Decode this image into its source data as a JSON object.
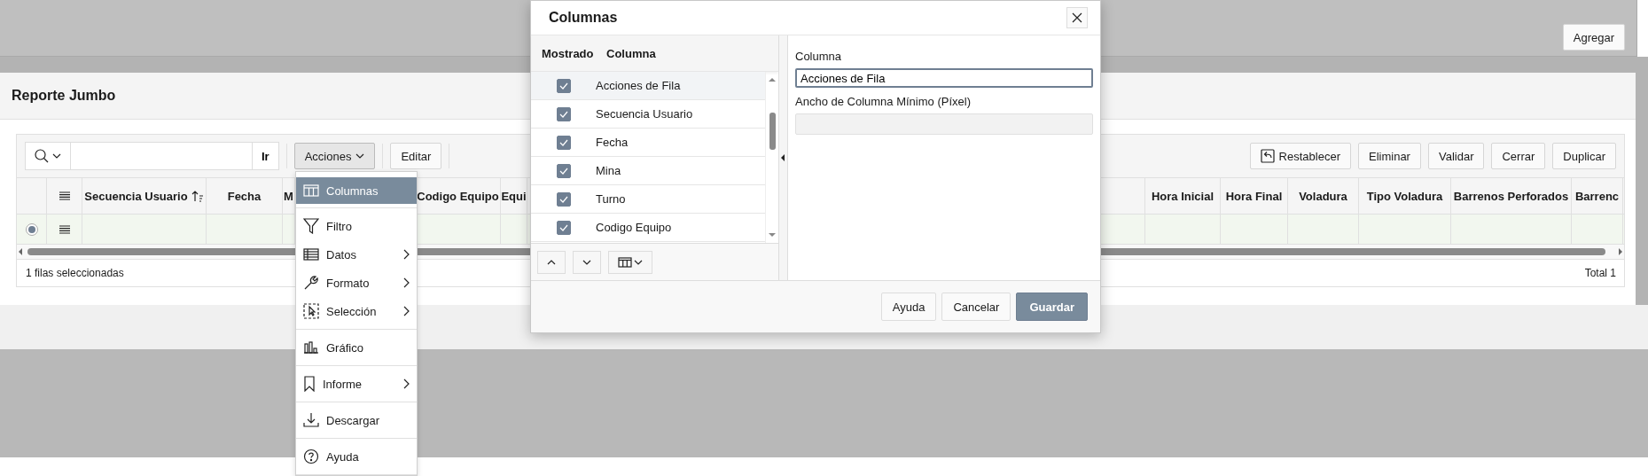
{
  "top_panel": {
    "button": "Agregar"
  },
  "report": {
    "title": "Reporte Jumbo",
    "toolbar": {
      "go_button": "Ir",
      "actions_button": "Acciones",
      "edit_button": "Editar",
      "right_buttons": [
        {
          "label": "Restablecer",
          "kind": "reset"
        },
        {
          "label": "Eliminar",
          "kind": "plain"
        },
        {
          "label": "Validar",
          "kind": "plain"
        },
        {
          "label": "Cerrar",
          "kind": "plain"
        },
        {
          "label": "Duplicar",
          "kind": "plain"
        }
      ]
    },
    "columns": [
      {
        "label": "Secuencia Usuario",
        "sorted": true
      },
      {
        "label": "Fecha",
        "sorted": false
      },
      {
        "label": "M",
        "sorted": false
      },
      {
        "label": "Codigo Equipo",
        "sorted": false
      },
      {
        "label": "Equi",
        "sorted": false
      },
      {
        "label": "Hora Inicial",
        "sorted": false
      },
      {
        "label": "Hora Final",
        "sorted": false
      },
      {
        "label": "Voladura",
        "sorted": false
      },
      {
        "label": "Tipo Voladura",
        "sorted": false
      },
      {
        "label": "Barrenos Perforados",
        "sorted": false
      },
      {
        "label": "Barrenc",
        "sorted": false
      }
    ],
    "rows": [
      {
        "selected": true
      }
    ],
    "footer": {
      "selection": "1 filas seleccionadas",
      "total": "Total 1"
    }
  },
  "actions_menu": {
    "groups": [
      [
        {
          "label": "Columnas",
          "selected": true,
          "submenu": false
        }
      ],
      [
        {
          "label": "Filtro",
          "selected": false,
          "submenu": false
        },
        {
          "label": "Datos",
          "selected": false,
          "submenu": true
        },
        {
          "label": "Formato",
          "selected": false,
          "submenu": true
        },
        {
          "label": "Selección",
          "selected": false,
          "submenu": true
        }
      ],
      [
        {
          "label": "Gráfico",
          "selected": false,
          "submenu": false
        }
      ],
      [
        {
          "label": "Informe",
          "selected": false,
          "submenu": true
        }
      ],
      [
        {
          "label": "Descargar",
          "selected": false,
          "submenu": false
        }
      ],
      [
        {
          "label": "Ayuda",
          "selected": false,
          "submenu": false
        }
      ]
    ]
  },
  "dialog": {
    "title": "Columnas",
    "list_headers": [
      "Mostrado",
      "Columna"
    ],
    "items": [
      {
        "label": "Acciones de Fila",
        "checked": true,
        "selected": true
      },
      {
        "label": "Secuencia Usuario",
        "checked": true,
        "selected": false
      },
      {
        "label": "Fecha",
        "checked": true,
        "selected": false
      },
      {
        "label": "Mina",
        "checked": true,
        "selected": false
      },
      {
        "label": "Turno",
        "checked": true,
        "selected": false
      },
      {
        "label": "Codigo Equipo",
        "checked": true,
        "selected": false
      }
    ],
    "fields": [
      {
        "label": "Columna",
        "value": "Acciones de Fila",
        "focused": true,
        "disabled": false
      },
      {
        "label": "Ancho de Columna Mínimo (Píxel)",
        "focused": false,
        "disabled": true
      }
    ],
    "buttons": [
      {
        "label": "Ayuda",
        "primary": false
      },
      {
        "label": "Cancelar",
        "primary": false
      },
      {
        "label": "Guardar",
        "primary": true
      }
    ]
  }
}
